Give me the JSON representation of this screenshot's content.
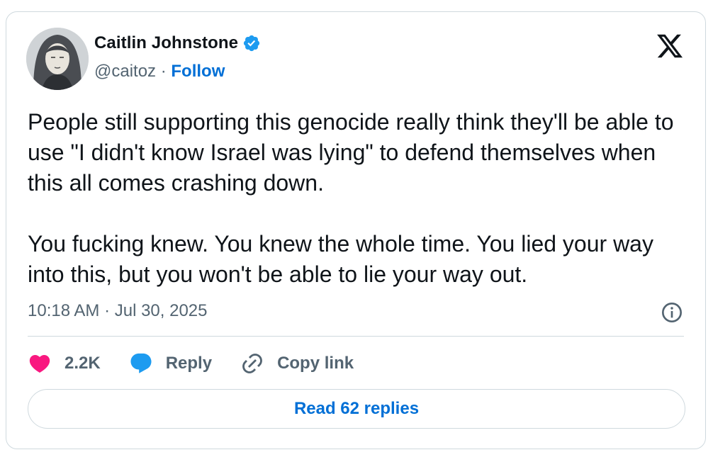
{
  "author": {
    "name": "Caitlin Johnstone",
    "handle": "@caitoz",
    "separator": " · ",
    "follow_label": "Follow",
    "verified_badge_icon": "verified-badge-icon",
    "avatar": "avatar-portrait"
  },
  "logo_icon": "x-logo-icon",
  "tweet": {
    "text": "People still supporting this genocide really think they'll be able to use \"I didn't know Israel was lying\" to defend themselves when this all comes crashing down.\n\nYou fucking knew. You knew the whole time. You lied your way into this, but you won't be able to lie your way out.",
    "timestamp": "10:18 AM · Jul 30, 2025"
  },
  "actions": {
    "like_count": "2.2K",
    "reply_label": "Reply",
    "copy_label": "Copy link"
  },
  "read_replies_label": "Read 62 replies",
  "colors": {
    "accent": "#006fd6",
    "verified": "#1d9bf0",
    "like": "#f91880",
    "muted": "#536471",
    "border": "#cfd9de"
  }
}
